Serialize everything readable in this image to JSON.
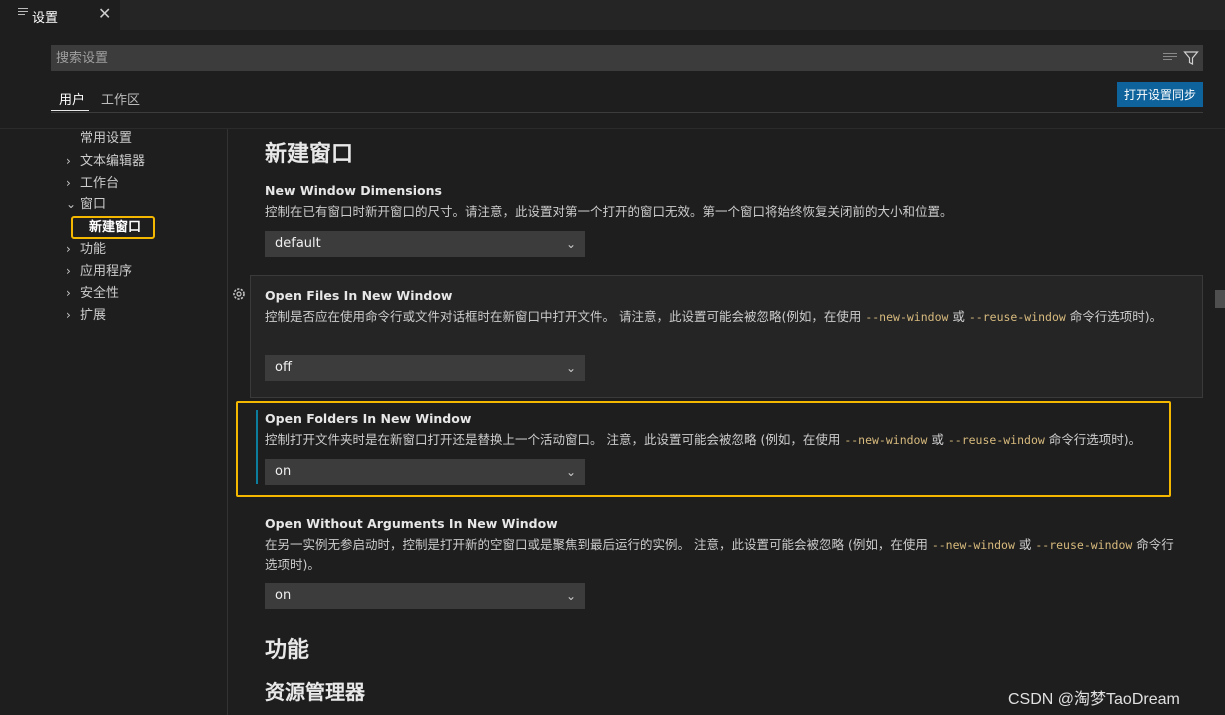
{
  "tab": {
    "icon": "settings-lines-icon",
    "label": "设置",
    "close_icon": "close-icon"
  },
  "search": {
    "placeholder": "搜索设置",
    "value": "",
    "clear_icon": "clear-filter-icon",
    "filter_icon": "filter-icon"
  },
  "scopes": {
    "user": "用户",
    "workspace": "工作区",
    "sync_button": "打开设置同步"
  },
  "toc": {
    "items": [
      {
        "label": "常用设置",
        "chevron": ""
      },
      {
        "label": "文本编辑器",
        "chevron": "›"
      },
      {
        "label": "工作台",
        "chevron": "›"
      },
      {
        "label": "窗口",
        "chevron": "⌄"
      },
      {
        "label": "功能",
        "chevron": "›"
      },
      {
        "label": "应用程序",
        "chevron": "›"
      },
      {
        "label": "安全性",
        "chevron": "›"
      },
      {
        "label": "扩展",
        "chevron": "›"
      }
    ],
    "selected_child": "新建窗口"
  },
  "content": {
    "section_title": "新建窗口",
    "settings": [
      {
        "title": "New Window Dimensions",
        "desc": "控制在已有窗口时新开窗口的尺寸。请注意，此设置对第一个打开的窗口无效。第一个窗口将始终恢复关闭前的大小和位置。",
        "value": "default"
      },
      {
        "title": "Open Files In New Window",
        "desc_pre": "控制是否应在使用命令行或文件对话框时在新窗口中打开文件。 请注意，此设置可能会被忽略(例如，在使用 ",
        "code1": "--new-window",
        "desc_mid": " 或 ",
        "code2": "--reuse-window",
        "desc_post": " 命令行选项时)。",
        "value": "off"
      },
      {
        "title": "Open Folders In New Window",
        "desc_pre": "控制打开文件夹时是在新窗口打开还是替换上一个活动窗口。 注意，此设置可能会被忽略 (例如，在使用 ",
        "code1": "--new-window",
        "desc_mid": " 或 ",
        "code2": "--reuse-window",
        "desc_post": " 命令行选项时)。",
        "value": "on"
      },
      {
        "title": "Open Without Arguments In New Window",
        "desc_pre": "在另一实例无参启动时，控制是打开新的空窗口或是聚焦到最后运行的实例。 注意，此设置可能会被忽略 (例如，在使用 ",
        "code1": "--new-window",
        "desc_mid": " 或 ",
        "code2": "--reuse-window",
        "desc_post": " 命令行选项时)。",
        "value": "on"
      }
    ],
    "next_section": "功能",
    "next_subsection": "资源管理器"
  },
  "watermark": "CSDN @淘梦TaoDream",
  "colors": {
    "accent": "#0e639c",
    "highlight": "#f5b800",
    "modified": "#0c7d9d",
    "code": "#d7ba7d"
  }
}
